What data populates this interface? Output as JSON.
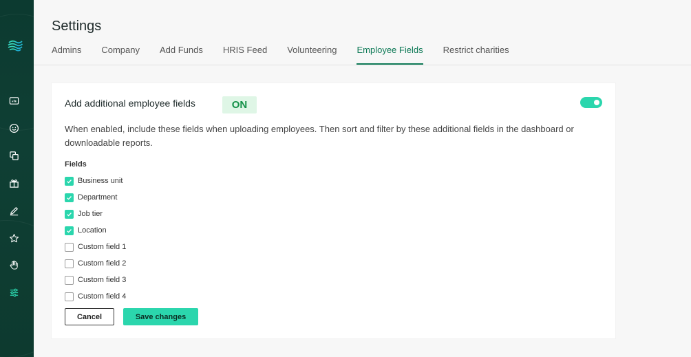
{
  "header": {
    "title": "Settings",
    "tabs": [
      {
        "label": "Admins"
      },
      {
        "label": "Company"
      },
      {
        "label": "Add Funds"
      },
      {
        "label": "HRIS Feed"
      },
      {
        "label": "Volunteering"
      },
      {
        "label": "Employee Fields",
        "active": true
      },
      {
        "label": "Restrict charities"
      }
    ]
  },
  "sidebar": {
    "items": [
      {
        "icon": "analytics-icon"
      },
      {
        "icon": "smiley-icon"
      },
      {
        "icon": "copy-icon"
      },
      {
        "icon": "gift-icon"
      },
      {
        "icon": "pen-icon"
      },
      {
        "icon": "star-icon"
      },
      {
        "icon": "hand-icon"
      },
      {
        "icon": "sliders-icon",
        "active": true
      }
    ]
  },
  "card": {
    "title": "Add additional employee fields",
    "badge": "ON",
    "toggle_on": true,
    "description": "When enabled, include these fields when uploading employees. Then sort and filter by these additional fields in the dashboard or downloadable reports.",
    "fields_label": "Fields",
    "fields": [
      {
        "label": "Business unit",
        "checked": true
      },
      {
        "label": "Department",
        "checked": true
      },
      {
        "label": "Job tier",
        "checked": true
      },
      {
        "label": "Location",
        "checked": true
      },
      {
        "label": "Custom field 1",
        "checked": false
      },
      {
        "label": "Custom field 2",
        "checked": false
      },
      {
        "label": "Custom field 3",
        "checked": false
      },
      {
        "label": "Custom field 4",
        "checked": false
      }
    ],
    "cancel_label": "Cancel",
    "save_label": "Save changes"
  },
  "colors": {
    "accent": "#2bd6ad",
    "active_tab": "#0f7a57",
    "sidebar_bg": "#0d3a2f",
    "badge_bg": "#dff6e6",
    "badge_text": "#149148"
  }
}
